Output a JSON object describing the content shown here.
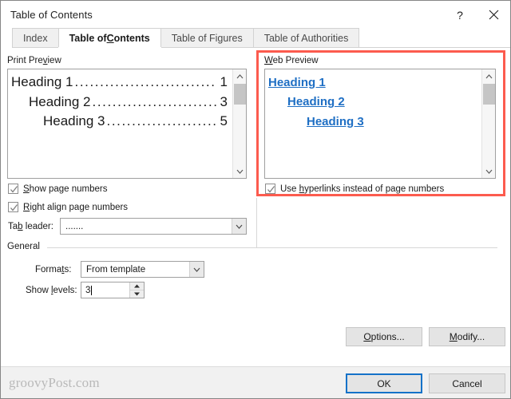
{
  "window": {
    "title": "Table of Contents",
    "help_icon": "question-mark-icon",
    "close_icon": "close-icon",
    "help_label": "?",
    "close_label": "✕"
  },
  "tabs": [
    {
      "label": "Index",
      "accel": "",
      "active": false
    },
    {
      "label": "Table of ",
      "accel": "C",
      "label_tail": "ontents",
      "active": true
    },
    {
      "label": "Table of Figures",
      "accel": "",
      "active": false
    },
    {
      "label": "Table of Authorities",
      "accel": "",
      "active": false
    }
  ],
  "print_preview": {
    "group_label_head": "Print Pre",
    "group_label_accel": "v",
    "group_label_tail": "iew",
    "lines": [
      {
        "text": "Heading 1",
        "dots": "................................................",
        "page": "1",
        "indent": 0
      },
      {
        "text": "Heading 2",
        "dots": "...........................................",
        "page": "3",
        "indent": 22
      },
      {
        "text": "Heading 3",
        "dots": ".....................................",
        "page": "5",
        "indent": 40
      }
    ],
    "checkboxes": [
      {
        "head": "",
        "accel": "S",
        "tail": "how page numbers",
        "checked": true
      },
      {
        "head": "",
        "accel": "R",
        "tail": "ight align page numbers",
        "checked": true
      }
    ],
    "tab_leader": {
      "label_head": "Ta",
      "label_accel": "b",
      "label_tail": " leader:",
      "value": ".......",
      "arrow_icon": "chevron-down-icon"
    }
  },
  "web_preview": {
    "group_label_head": "",
    "group_label_accel": "W",
    "group_label_tail": "eb Preview",
    "lines": [
      {
        "text": "Heading 1",
        "indent": 0
      },
      {
        "text": "Heading 2",
        "indent": 24
      },
      {
        "text": "Heading 3",
        "indent": 48
      }
    ],
    "checkbox": {
      "head": "Use ",
      "accel": "h",
      "tail": "yperlinks instead of page numbers",
      "checked": true
    },
    "highlight_color": "#fc5b4e"
  },
  "general": {
    "group_label": "General",
    "formats": {
      "label_head": "Forma",
      "label_accel": "t",
      "label_tail": "s:",
      "value": "From template",
      "arrow_icon": "chevron-down-icon"
    },
    "show_levels": {
      "label_head": "Show ",
      "label_accel": "l",
      "label_tail": "evels:",
      "value": "3",
      "up_icon": "spinner-up-icon",
      "down_icon": "spinner-down-icon"
    }
  },
  "buttons": {
    "options": {
      "head": "",
      "accel": "O",
      "tail": "ptions..."
    },
    "modify": {
      "head": "",
      "accel": "M",
      "tail": "odify..."
    },
    "ok": "OK",
    "cancel": "Cancel"
  },
  "watermark": "groovyPost.com"
}
